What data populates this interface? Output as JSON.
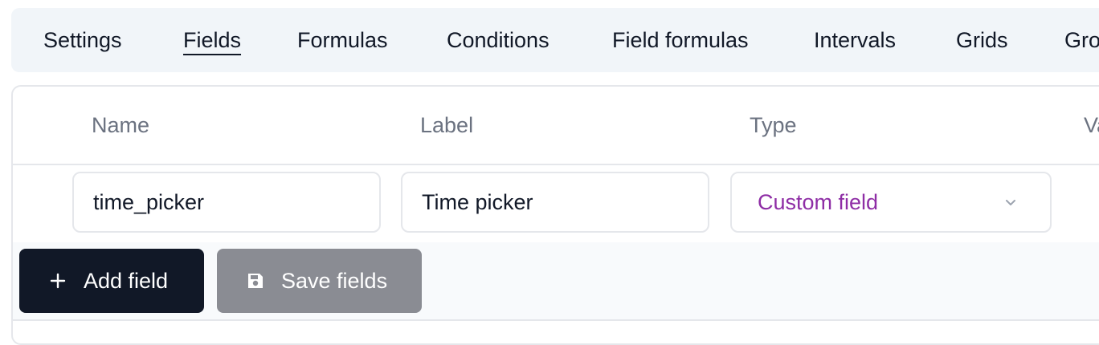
{
  "tabs": [
    {
      "label": "Settings"
    },
    {
      "label": "Fields",
      "active": true
    },
    {
      "label": "Formulas"
    },
    {
      "label": "Conditions"
    },
    {
      "label": "Field formulas"
    },
    {
      "label": "Intervals"
    },
    {
      "label": "Grids"
    },
    {
      "label": "Groups"
    }
  ],
  "table": {
    "columns": [
      "Name",
      "Label",
      "Type",
      "Value"
    ],
    "rows": [
      {
        "name": "time_picker",
        "label": "Time picker",
        "type": "Custom field"
      }
    ]
  },
  "actions": {
    "add_label": "Add field",
    "save_label": "Save fields"
  },
  "colors": {
    "type_select_text": "#8e2da5",
    "primary_button": "#111827",
    "disabled_button": "#8a8c93"
  },
  "icons": {
    "add": "plus-icon",
    "save": "floppy-disk-icon",
    "select": "chevron-down-icon"
  }
}
